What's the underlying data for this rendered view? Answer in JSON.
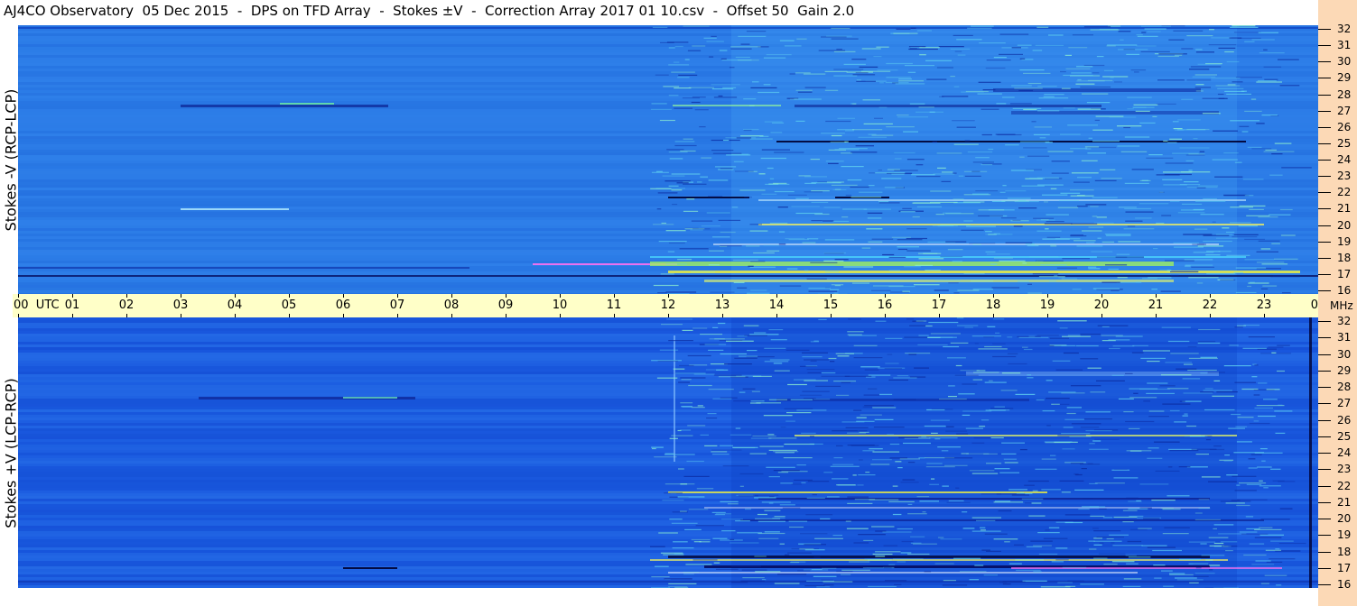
{
  "title": "AJ4CO Observatory  05 Dec 2015  -  DPS on TFD Array  -  Stokes ±V  -  Correction Array 2017 01 10.csv  -  Offset 50  Gain 2.0",
  "colors": {
    "background_blue": "#2a7ae6",
    "deep_blue": "#1550d8",
    "frequency_column": "#fcd9b6",
    "time_bar": "#ffffc8"
  },
  "chart_data": [
    {
      "type": "heatmap",
      "panel": "upper",
      "ylabel": "Stokes -V (RCP-LCP)",
      "x_unit": "UTC",
      "x": [
        "00",
        "01",
        "02",
        "03",
        "04",
        "05",
        "06",
        "07",
        "08",
        "09",
        "10",
        "11",
        "12",
        "13",
        "14",
        "15",
        "16",
        "17",
        "18",
        "19",
        "20",
        "21",
        "22",
        "23",
        "00"
      ],
      "y_unit": "MHz",
      "y": [
        32,
        31,
        30,
        29,
        28,
        27,
        26,
        25,
        24,
        23,
        22,
        21,
        20,
        19,
        18,
        17,
        16
      ],
      "ylim": [
        16,
        32
      ]
    },
    {
      "type": "heatmap",
      "panel": "lower",
      "ylabel": "Stokes +V (LCP-RCP)",
      "x_unit": "UTC",
      "x": [
        "00",
        "01",
        "02",
        "03",
        "04",
        "05",
        "06",
        "07",
        "08",
        "09",
        "10",
        "11",
        "12",
        "13",
        "14",
        "15",
        "16",
        "17",
        "18",
        "19",
        "20",
        "21",
        "22",
        "23",
        "00"
      ],
      "y_unit": "MHz",
      "y": [
        32,
        31,
        30,
        29,
        28,
        27,
        26,
        25,
        24,
        23,
        22,
        21,
        20,
        19,
        18,
        17,
        16
      ],
      "ylim": [
        16,
        32
      ]
    }
  ]
}
